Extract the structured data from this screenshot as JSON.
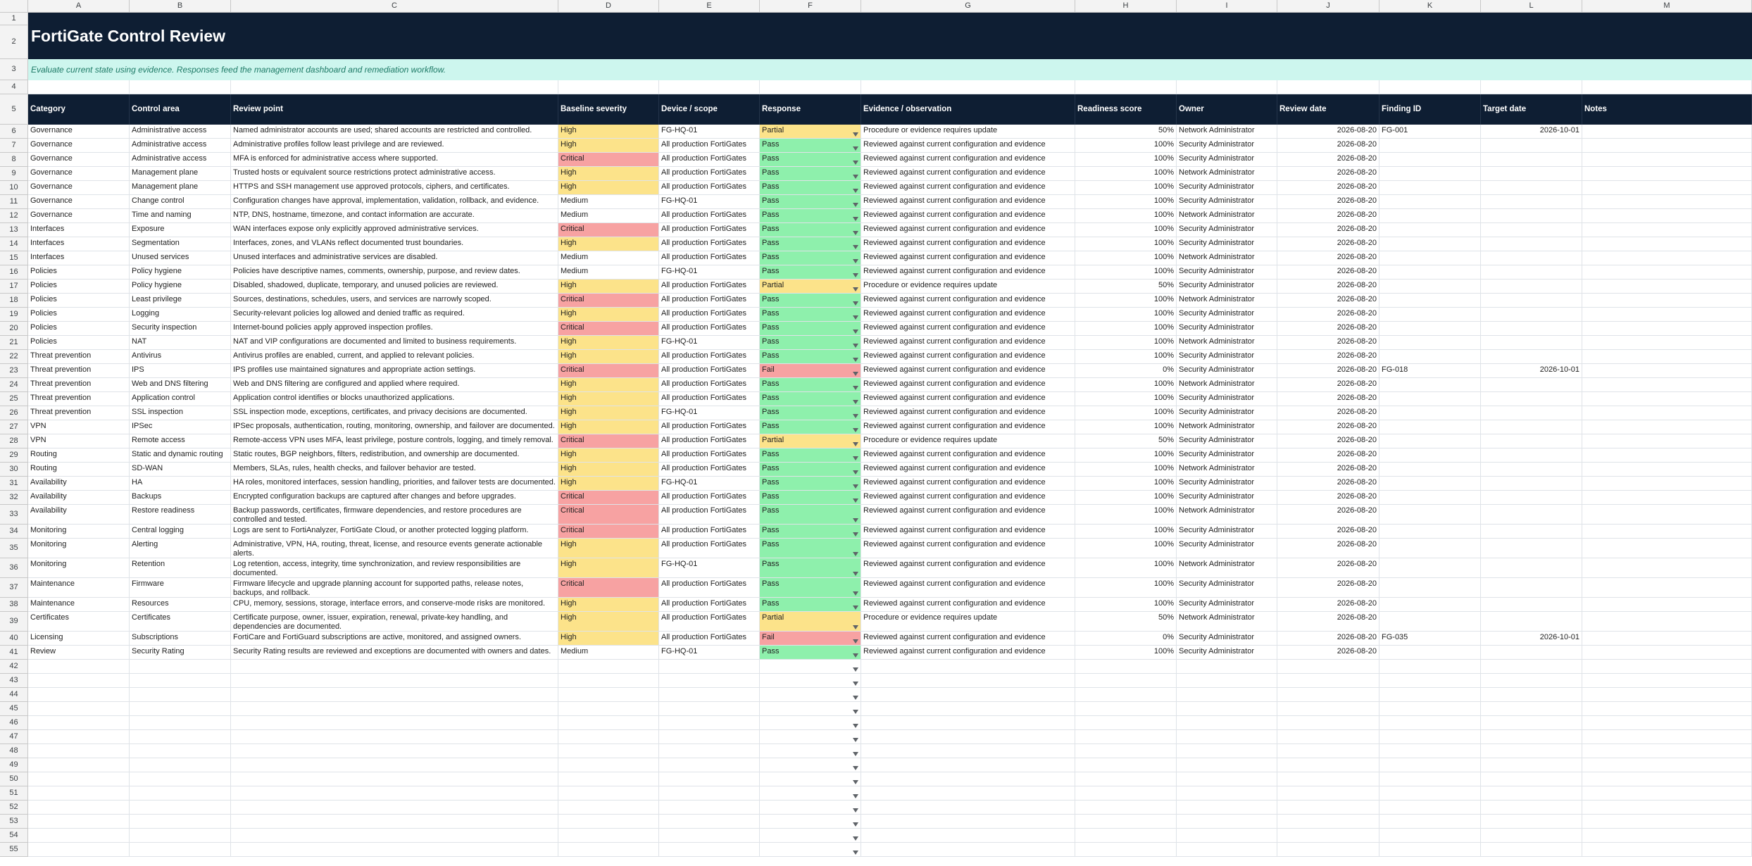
{
  "sheet": {
    "title": "FortiGate Control Review",
    "subtitle": "Evaluate current state using evidence. Responses feed the management dashboard and remediation workflow.",
    "column_letters": [
      "A",
      "B",
      "C",
      "D",
      "E",
      "F",
      "G",
      "H",
      "I",
      "J",
      "K",
      "L",
      "M"
    ],
    "headers": [
      "Category",
      "Control area",
      "Review point",
      "Baseline severity",
      "Device / scope",
      "Response",
      "Evidence / observation",
      "Readiness score",
      "Owner",
      "Review date",
      "Finding ID",
      "Target date",
      "Notes"
    ],
    "rows": [
      [
        "Governance",
        "Administrative access",
        "Named administrator accounts are used; shared accounts are restricted and controlled.",
        "High",
        "FG-HQ-01",
        "Partial",
        "Procedure or evidence requires update",
        "50%",
        "Network Administrator",
        "2026-08-20",
        "FG-001",
        "2026-10-01",
        ""
      ],
      [
        "Governance",
        "Administrative access",
        "Administrative profiles follow least privilege and are reviewed.",
        "High",
        "All production FortiGates",
        "Pass",
        "Reviewed against current configuration and evidence",
        "100%",
        "Security Administrator",
        "2026-08-20",
        "",
        "",
        ""
      ],
      [
        "Governance",
        "Administrative access",
        "MFA is enforced for administrative access where supported.",
        "Critical",
        "All production FortiGates",
        "Pass",
        "Reviewed against current configuration and evidence",
        "100%",
        "Security Administrator",
        "2026-08-20",
        "",
        "",
        ""
      ],
      [
        "Governance",
        "Management plane",
        "Trusted hosts or equivalent source restrictions protect administrative access.",
        "High",
        "All production FortiGates",
        "Pass",
        "Reviewed against current configuration and evidence",
        "100%",
        "Network Administrator",
        "2026-08-20",
        "",
        "",
        ""
      ],
      [
        "Governance",
        "Management plane",
        "HTTPS and SSH management use approved protocols, ciphers, and certificates.",
        "High",
        "All production FortiGates",
        "Pass",
        "Reviewed against current configuration and evidence",
        "100%",
        "Security Administrator",
        "2026-08-20",
        "",
        "",
        ""
      ],
      [
        "Governance",
        "Change control",
        "Configuration changes have approval, implementation, validation, rollback, and evidence.",
        "Medium",
        "FG-HQ-01",
        "Pass",
        "Reviewed against current configuration and evidence",
        "100%",
        "Security Administrator",
        "2026-08-20",
        "",
        "",
        ""
      ],
      [
        "Governance",
        "Time and naming",
        "NTP, DNS, hostname, timezone, and contact information are accurate.",
        "Medium",
        "All production FortiGates",
        "Pass",
        "Reviewed against current configuration and evidence",
        "100%",
        "Network Administrator",
        "2026-08-20",
        "",
        "",
        ""
      ],
      [
        "Interfaces",
        "Exposure",
        "WAN interfaces expose only explicitly approved administrative services.",
        "Critical",
        "All production FortiGates",
        "Pass",
        "Reviewed against current configuration and evidence",
        "100%",
        "Security Administrator",
        "2026-08-20",
        "",
        "",
        ""
      ],
      [
        "Interfaces",
        "Segmentation",
        "Interfaces, zones, and VLANs reflect documented trust boundaries.",
        "High",
        "All production FortiGates",
        "Pass",
        "Reviewed against current configuration and evidence",
        "100%",
        "Security Administrator",
        "2026-08-20",
        "",
        "",
        ""
      ],
      [
        "Interfaces",
        "Unused services",
        "Unused interfaces and administrative services are disabled.",
        "Medium",
        "All production FortiGates",
        "Pass",
        "Reviewed against current configuration and evidence",
        "100%",
        "Network Administrator",
        "2026-08-20",
        "",
        "",
        ""
      ],
      [
        "Policies",
        "Policy hygiene",
        "Policies have descriptive names, comments, ownership, purpose, and review dates.",
        "Medium",
        "FG-HQ-01",
        "Pass",
        "Reviewed against current configuration and evidence",
        "100%",
        "Security Administrator",
        "2026-08-20",
        "",
        "",
        ""
      ],
      [
        "Policies",
        "Policy hygiene",
        "Disabled, shadowed, duplicate, temporary, and unused policies are reviewed.",
        "High",
        "All production FortiGates",
        "Partial",
        "Procedure or evidence requires update",
        "50%",
        "Security Administrator",
        "2026-08-20",
        "",
        "",
        ""
      ],
      [
        "Policies",
        "Least privilege",
        "Sources, destinations, schedules, users, and services are narrowly scoped.",
        "Critical",
        "All production FortiGates",
        "Pass",
        "Reviewed against current configuration and evidence",
        "100%",
        "Network Administrator",
        "2026-08-20",
        "",
        "",
        ""
      ],
      [
        "Policies",
        "Logging",
        "Security-relevant policies log allowed and denied traffic as required.",
        "High",
        "All production FortiGates",
        "Pass",
        "Reviewed against current configuration and evidence",
        "100%",
        "Security Administrator",
        "2026-08-20",
        "",
        "",
        ""
      ],
      [
        "Policies",
        "Security inspection",
        "Internet-bound policies apply approved inspection profiles.",
        "Critical",
        "All production FortiGates",
        "Pass",
        "Reviewed against current configuration and evidence",
        "100%",
        "Security Administrator",
        "2026-08-20",
        "",
        "",
        ""
      ],
      [
        "Policies",
        "NAT",
        "NAT and VIP configurations are documented and limited to business requirements.",
        "High",
        "FG-HQ-01",
        "Pass",
        "Reviewed against current configuration and evidence",
        "100%",
        "Network Administrator",
        "2026-08-20",
        "",
        "",
        ""
      ],
      [
        "Threat prevention",
        "Antivirus",
        "Antivirus profiles are enabled, current, and applied to relevant policies.",
        "High",
        "All production FortiGates",
        "Pass",
        "Reviewed against current configuration and evidence",
        "100%",
        "Security Administrator",
        "2026-08-20",
        "",
        "",
        ""
      ],
      [
        "Threat prevention",
        "IPS",
        "IPS profiles use maintained signatures and appropriate action settings.",
        "Critical",
        "All production FortiGates",
        "Fail",
        "Reviewed against current configuration and evidence",
        "0%",
        "Security Administrator",
        "2026-08-20",
        "FG-018",
        "2026-10-01",
        ""
      ],
      [
        "Threat prevention",
        "Web and DNS filtering",
        "Web and DNS filtering are configured and applied where required.",
        "High",
        "All production FortiGates",
        "Pass",
        "Reviewed against current configuration and evidence",
        "100%",
        "Network Administrator",
        "2026-08-20",
        "",
        "",
        ""
      ],
      [
        "Threat prevention",
        "Application control",
        "Application control identifies or blocks unauthorized applications.",
        "High",
        "All production FortiGates",
        "Pass",
        "Reviewed against current configuration and evidence",
        "100%",
        "Security Administrator",
        "2026-08-20",
        "",
        "",
        ""
      ],
      [
        "Threat prevention",
        "SSL inspection",
        "SSL inspection mode, exceptions, certificates, and privacy decisions are documented.",
        "High",
        "FG-HQ-01",
        "Pass",
        "Reviewed against current configuration and evidence",
        "100%",
        "Security Administrator",
        "2026-08-20",
        "",
        "",
        ""
      ],
      [
        "VPN",
        "IPSec",
        "IPSec proposals, authentication, routing, monitoring, ownership, and failover are documented.",
        "High",
        "All production FortiGates",
        "Pass",
        "Reviewed against current configuration and evidence",
        "100%",
        "Network Administrator",
        "2026-08-20",
        "",
        "",
        ""
      ],
      [
        "VPN",
        "Remote access",
        "Remote-access VPN uses MFA, least privilege, posture controls, logging, and timely removal.",
        "Critical",
        "All production FortiGates",
        "Partial",
        "Procedure or evidence requires update",
        "50%",
        "Security Administrator",
        "2026-08-20",
        "",
        "",
        ""
      ],
      [
        "Routing",
        "Static and dynamic routing",
        "Static routes, BGP neighbors, filters, redistribution, and ownership are documented.",
        "High",
        "All production FortiGates",
        "Pass",
        "Reviewed against current configuration and evidence",
        "100%",
        "Security Administrator",
        "2026-08-20",
        "",
        "",
        ""
      ],
      [
        "Routing",
        "SD-WAN",
        "Members, SLAs, rules, health checks, and failover behavior are tested.",
        "High",
        "All production FortiGates",
        "Pass",
        "Reviewed against current configuration and evidence",
        "100%",
        "Network Administrator",
        "2026-08-20",
        "",
        "",
        ""
      ],
      [
        "Availability",
        "HA",
        "HA roles, monitored interfaces, session handling, priorities, and failover tests are documented.",
        "High",
        "FG-HQ-01",
        "Pass",
        "Reviewed against current configuration and evidence",
        "100%",
        "Security Administrator",
        "2026-08-20",
        "",
        "",
        ""
      ],
      [
        "Availability",
        "Backups",
        "Encrypted configuration backups are captured after changes and before upgrades.",
        "Critical",
        "All production FortiGates",
        "Pass",
        "Reviewed against current configuration and evidence",
        "100%",
        "Security Administrator",
        "2026-08-20",
        "",
        "",
        ""
      ],
      [
        "Availability",
        "Restore readiness",
        "Backup passwords, certificates, firmware dependencies, and restore procedures are controlled and tested.",
        "Critical",
        "All production FortiGates",
        "Pass",
        "Reviewed against current configuration and evidence",
        "100%",
        "Network Administrator",
        "2026-08-20",
        "",
        "",
        ""
      ],
      [
        "Monitoring",
        "Central logging",
        "Logs are sent to FortiAnalyzer, FortiGate Cloud, or another protected logging platform.",
        "Critical",
        "All production FortiGates",
        "Pass",
        "Reviewed against current configuration and evidence",
        "100%",
        "Security Administrator",
        "2026-08-20",
        "",
        "",
        ""
      ],
      [
        "Monitoring",
        "Alerting",
        "Administrative, VPN, HA, routing, threat, license, and resource events generate actionable alerts.",
        "High",
        "All production FortiGates",
        "Pass",
        "Reviewed against current configuration and evidence",
        "100%",
        "Security Administrator",
        "2026-08-20",
        "",
        "",
        ""
      ],
      [
        "Monitoring",
        "Retention",
        "Log retention, access, integrity, time synchronization, and review responsibilities are documented.",
        "High",
        "FG-HQ-01",
        "Pass",
        "Reviewed against current configuration and evidence",
        "100%",
        "Network Administrator",
        "2026-08-20",
        "",
        "",
        ""
      ],
      [
        "Maintenance",
        "Firmware",
        "Firmware lifecycle and upgrade planning account for supported paths, release notes, backups, and rollback.",
        "Critical",
        "All production FortiGates",
        "Pass",
        "Reviewed against current configuration and evidence",
        "100%",
        "Security Administrator",
        "2026-08-20",
        "",
        "",
        ""
      ],
      [
        "Maintenance",
        "Resources",
        "CPU, memory, sessions, storage, interface errors, and conserve-mode risks are monitored.",
        "High",
        "All production FortiGates",
        "Pass",
        "Reviewed against current configuration and evidence",
        "100%",
        "Security Administrator",
        "2026-08-20",
        "",
        "",
        ""
      ],
      [
        "Certificates",
        "Certificates",
        "Certificate purpose, owner, issuer, expiration, renewal, private-key handling, and dependencies are documented.",
        "High",
        "All production FortiGates",
        "Partial",
        "Procedure or evidence requires update",
        "50%",
        "Network Administrator",
        "2026-08-20",
        "",
        "",
        ""
      ],
      [
        "Licensing",
        "Subscriptions",
        "FortiCare and FortiGuard subscriptions are active, monitored, and assigned owners.",
        "High",
        "All production FortiGates",
        "Fail",
        "Reviewed against current configuration and evidence",
        "0%",
        "Security Administrator",
        "2026-08-20",
        "FG-035",
        "2026-10-01",
        ""
      ],
      [
        "Review",
        "Security Rating",
        "Security Rating results are reviewed and exceptions are documented with owners and dates.",
        "Medium",
        "FG-HQ-01",
        "Pass",
        "Reviewed against current configuration and evidence",
        "100%",
        "Security Administrator",
        "2026-08-20",
        "",
        "",
        ""
      ]
    ],
    "empty_row_numbers": [
      42,
      43,
      44,
      45,
      46,
      47,
      48,
      49,
      50,
      51,
      52,
      53,
      54,
      55
    ]
  },
  "colors": {
    "title_band": "#0e1e33",
    "subtitle_band": "#cdf6ee",
    "high": "#fce38a",
    "critical": "#f7a2a2",
    "pass": "#8ef0ac",
    "partial": "#fce38a",
    "fail": "#f7a2a2"
  },
  "icons": {
    "dropdown": "dropdown-arrow-icon"
  }
}
